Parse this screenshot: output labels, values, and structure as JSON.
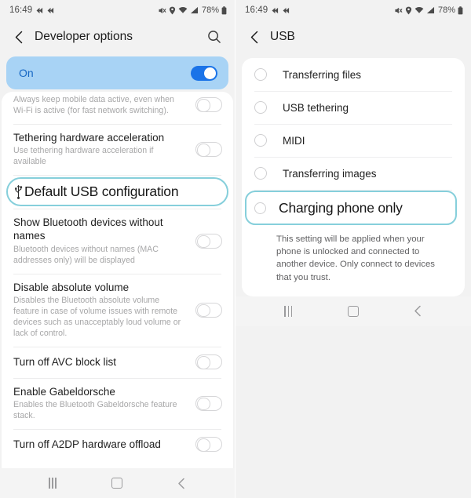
{
  "left_phone": {
    "status_bar": {
      "time": "16:49",
      "icons_left": [
        "rewind-icon",
        "rewind-icon"
      ],
      "icons_right": [
        "mute-icon",
        "location-icon",
        "wifi-icon",
        "signal-icon"
      ],
      "battery_text": "78%",
      "battery_icon": "battery-icon"
    },
    "app_bar": {
      "back_icon": "back-chevron-icon",
      "title": "Developer options",
      "search_icon": "search-icon"
    },
    "master_toggle": {
      "label": "On",
      "state": "on",
      "accent_color": "#1a73e8",
      "banner_color": "#a8d3f5",
      "label_color": "#1667c4"
    },
    "rows": [
      {
        "title": "",
        "subtitle": "Always keep mobile data active, even when Wi-Fi is active (for fast network switching).",
        "toggle": "off",
        "clipped": true
      },
      {
        "title": "Tethering hardware acceleration",
        "subtitle": "Use tethering hardware acceleration if available",
        "toggle": "off"
      },
      {
        "title": "Default USB configuration",
        "subtitle": "",
        "toggle": "none",
        "highlighted": true,
        "icon": "usb-icon"
      },
      {
        "title": "Show Bluetooth devices without names",
        "subtitle": "Bluetooth devices without names (MAC addresses only) will be displayed",
        "toggle": "off"
      },
      {
        "title": "Disable absolute volume",
        "subtitle": "Disables the Bluetooth absolute volume feature in case of volume issues with remote devices such as unacceptably loud volume or lack of control.",
        "toggle": "off"
      },
      {
        "title": "Turn off AVC block list",
        "subtitle": "",
        "toggle": "off"
      },
      {
        "title": "Enable Gabeldorsche",
        "subtitle": "Enables the Bluetooth Gabeldorsche feature stack.",
        "toggle": "off"
      },
      {
        "title": "Turn off A2DP hardware offload",
        "subtitle": "",
        "toggle": "off"
      }
    ],
    "nav_bar": {
      "recents": "recents-icon",
      "home": "home-icon",
      "back": "back-icon"
    }
  },
  "right_phone": {
    "status_bar": {
      "time": "16:49",
      "icons_left": [
        "rewind-icon",
        "rewind-icon"
      ],
      "icons_right": [
        "mute-icon",
        "location-icon",
        "wifi-icon",
        "signal-icon"
      ],
      "battery_text": "78%",
      "battery_icon": "battery-icon"
    },
    "app_bar": {
      "back_icon": "back-chevron-icon",
      "title": "USB"
    },
    "options": [
      {
        "label": "Transferring files",
        "selected": false
      },
      {
        "label": "USB tethering",
        "selected": false
      },
      {
        "label": "MIDI",
        "selected": false
      },
      {
        "label": "Transferring images",
        "selected": false
      },
      {
        "label": "Charging phone only",
        "selected": false,
        "highlighted": true
      }
    ],
    "footnote": "This setting will be applied when your phone is unlocked and connected to another device. Only connect to devices that you trust.",
    "nav_bar": {
      "recents": "recents-icon",
      "home": "home-icon",
      "back": "back-icon"
    }
  },
  "annotation": {
    "color": "#86cfdb",
    "shapes": [
      "oval-around-default-usb-configuration",
      "rounded-rect-around-charging-phone-only"
    ]
  }
}
